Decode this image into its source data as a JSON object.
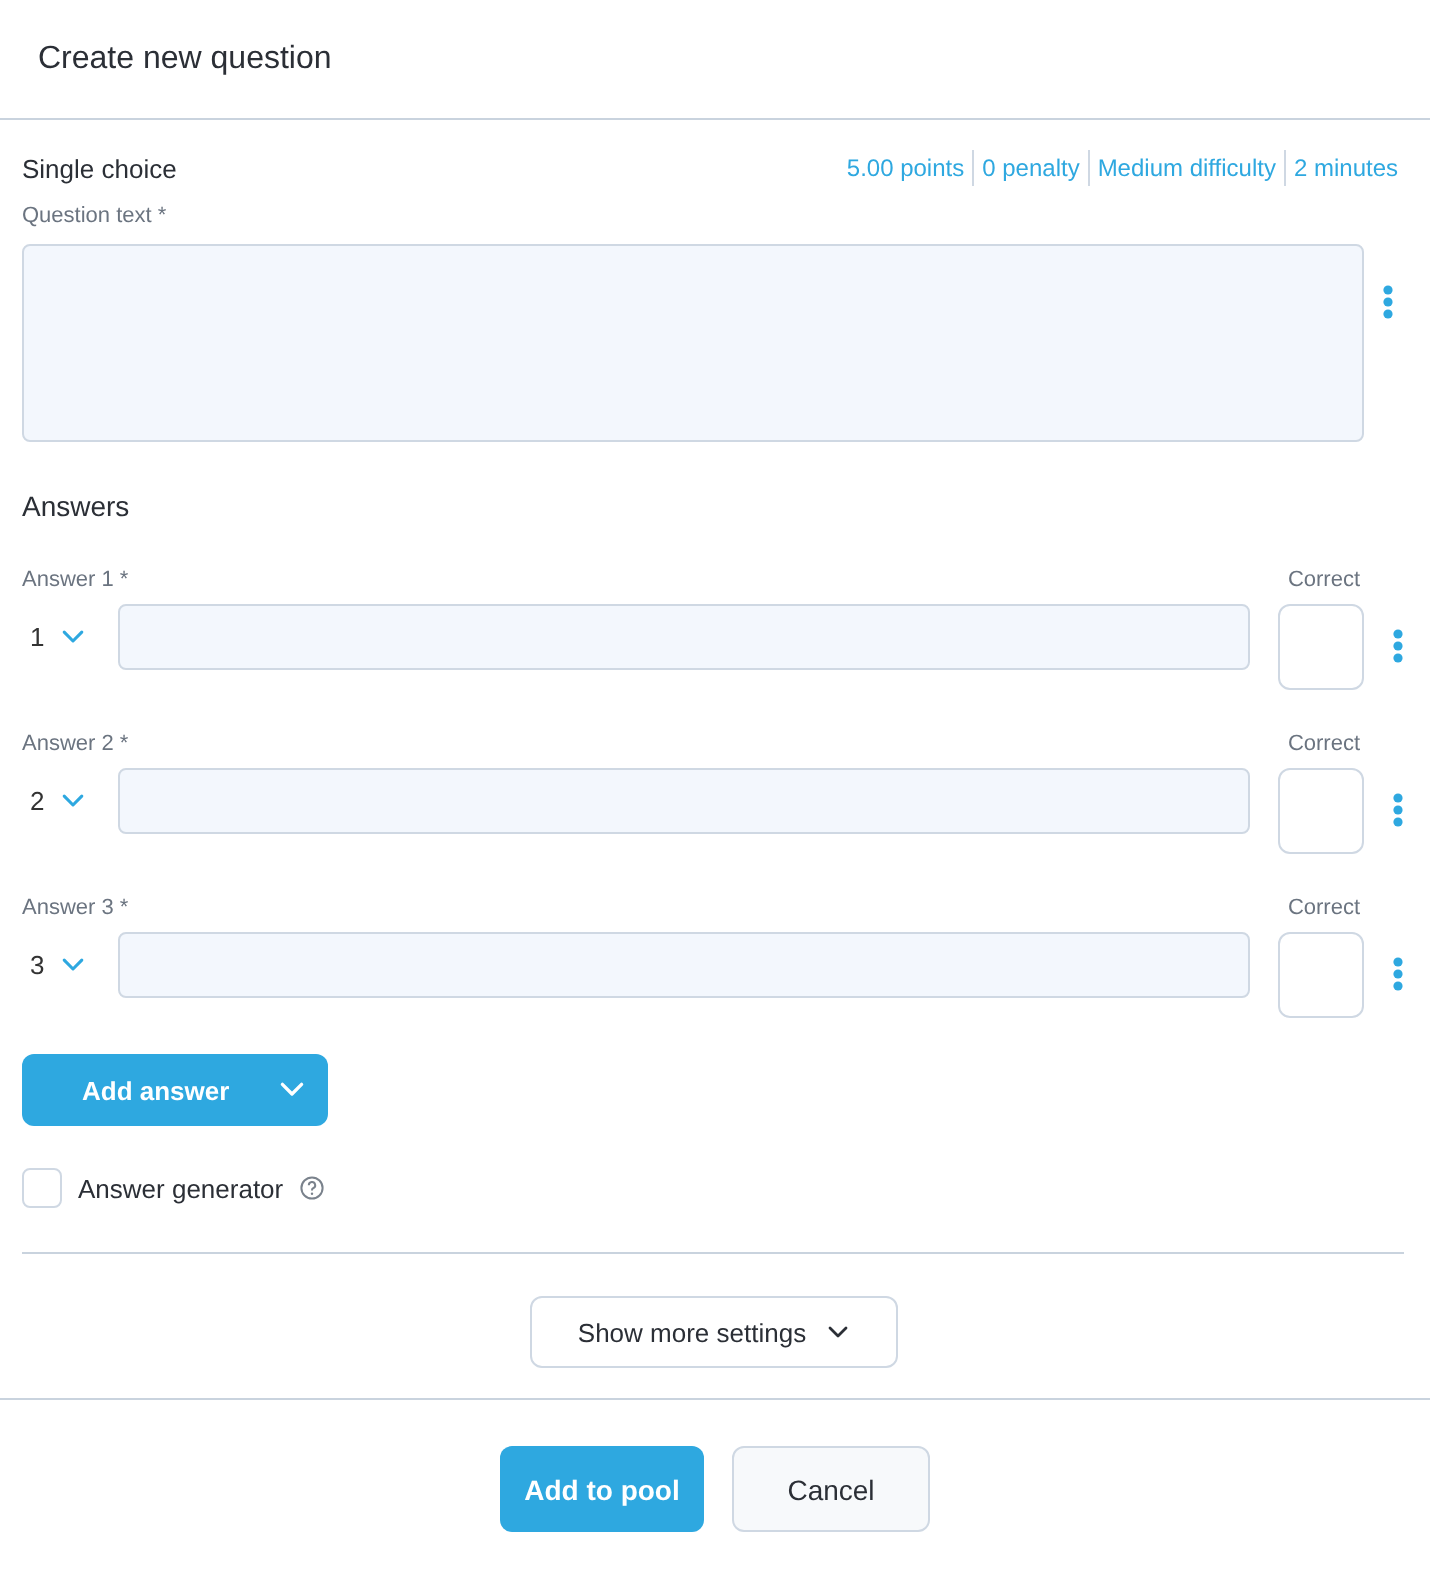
{
  "dialog": {
    "title": "Create new question"
  },
  "question_type": "Single choice",
  "meta": [
    "5.00 points",
    "0 penalty",
    "Medium difficulty",
    "2 minutes"
  ],
  "question_text": {
    "label": "Question text *"
  },
  "answers_heading": "Answers",
  "answers": [
    {
      "label": "Answer 1 *",
      "order": "1",
      "correct_label": "Correct",
      "checked": false
    },
    {
      "label": "Answer 2 *",
      "order": "2",
      "correct_label": "Correct",
      "checked": false
    },
    {
      "label": "Answer 3 *",
      "order": "3",
      "correct_label": "Correct",
      "checked": false
    }
  ],
  "add_answer_button": "Add answer",
  "answer_generator": {
    "label": "Answer generator",
    "checked": false
  },
  "show_more_button": "Show more settings",
  "footer_buttons": [
    {
      "label": "Add to pool",
      "kind": "primary"
    },
    {
      "label": "Cancel",
      "kind": "secondary"
    }
  ]
}
